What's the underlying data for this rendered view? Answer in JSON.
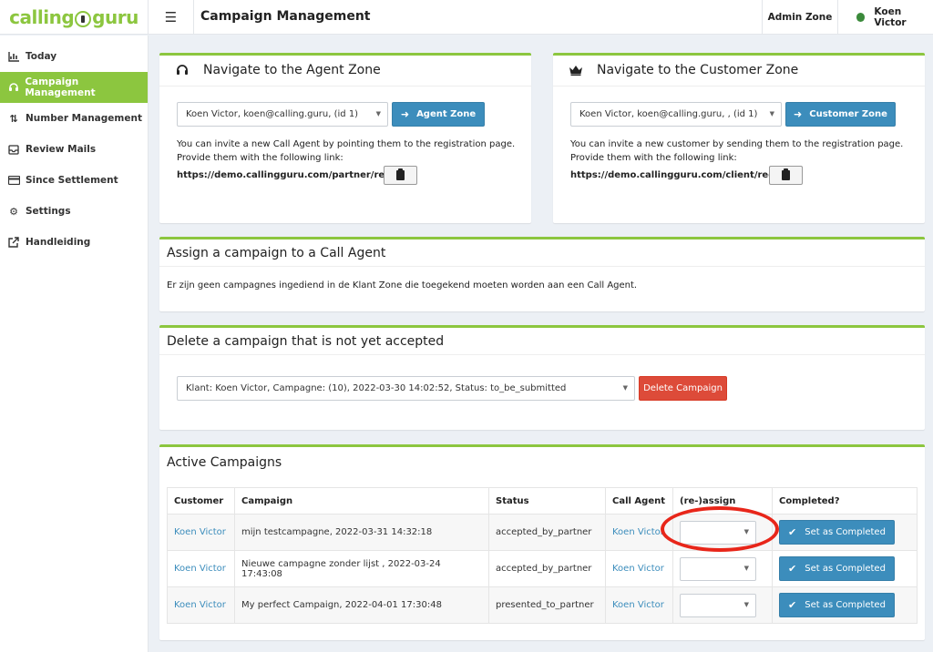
{
  "app": {
    "logo_left": "calling",
    "logo_right": "guru",
    "page_title": "Campaign Management"
  },
  "header": {
    "admin_zone": "Admin Zone",
    "user_name": "Koen Victor"
  },
  "sidebar": {
    "items": [
      {
        "label": "Today",
        "icon": "chart-icon"
      },
      {
        "label": "Campaign Management",
        "icon": "headset-icon"
      },
      {
        "label": "Number Management",
        "icon": "sort-icon"
      },
      {
        "label": "Review Mails",
        "icon": "inbox-icon"
      },
      {
        "label": "Since Settlement",
        "icon": "card-icon"
      },
      {
        "label": "Settings",
        "icon": "cogs-icon"
      },
      {
        "label": "Handleiding",
        "icon": "external-link-icon"
      }
    ]
  },
  "agent_zone": {
    "title": "Navigate to the Agent Zone",
    "select_value": "Koen Victor, koen@calling.guru, (id 1)",
    "button": "Agent Zone",
    "text1": "You can invite a new Call Agent by pointing them to the registration page.",
    "text2": "Provide them with the following link:",
    "link": "https://demo.callingguru.com/partner/register"
  },
  "customer_zone": {
    "title": "Navigate to the Customer Zone",
    "select_value": "Koen Victor, koen@calling.guru, , (id 1)",
    "button": "Customer Zone",
    "text1": "You can invite a new customer by sending them to the registration page.",
    "text2": "Provide them with the following link:",
    "link": "https://demo.callingguru.com/client/register"
  },
  "assign": {
    "title": "Assign a campaign to a Call Agent",
    "message": "Er zijn geen campagnes ingediend in de Klant Zone die toegekend moeten worden aan een Call Agent."
  },
  "delete": {
    "title": "Delete a campaign that is not yet accepted",
    "select_value": "Klant: Koen Victor, Campagne: (10), 2022-03-30 14:02:52, Status: to_be_submitted",
    "button": "Delete Campaign"
  },
  "active": {
    "title": "Active Campaigns",
    "columns": [
      "Customer",
      "Campaign",
      "Status",
      "Call Agent",
      "(re-)assign",
      "Completed?"
    ],
    "button_label": "Set as Completed",
    "rows": [
      {
        "customer": "Koen Victor",
        "campaign": "mijn testcampagne, 2022-03-31 14:32:18",
        "status": "accepted_by_partner",
        "agent": "Koen Victor"
      },
      {
        "customer": "Koen Victor",
        "campaign": "Nieuwe campagne zonder lijst , 2022-03-24 17:43:08",
        "status": "accepted_by_partner",
        "agent": "Koen Victor"
      },
      {
        "customer": "Koen Victor",
        "campaign": "My perfect Campaign, 2022-04-01 17:30:48",
        "status": "presented_to_partner",
        "agent": "Koen Victor"
      }
    ]
  },
  "colors": {
    "accent_green": "#8cc63f",
    "button_blue": "#3c8dbc",
    "button_red": "#dd4b39",
    "annotation_red": "#e8261a",
    "status_dot": "#3b8a3b"
  }
}
